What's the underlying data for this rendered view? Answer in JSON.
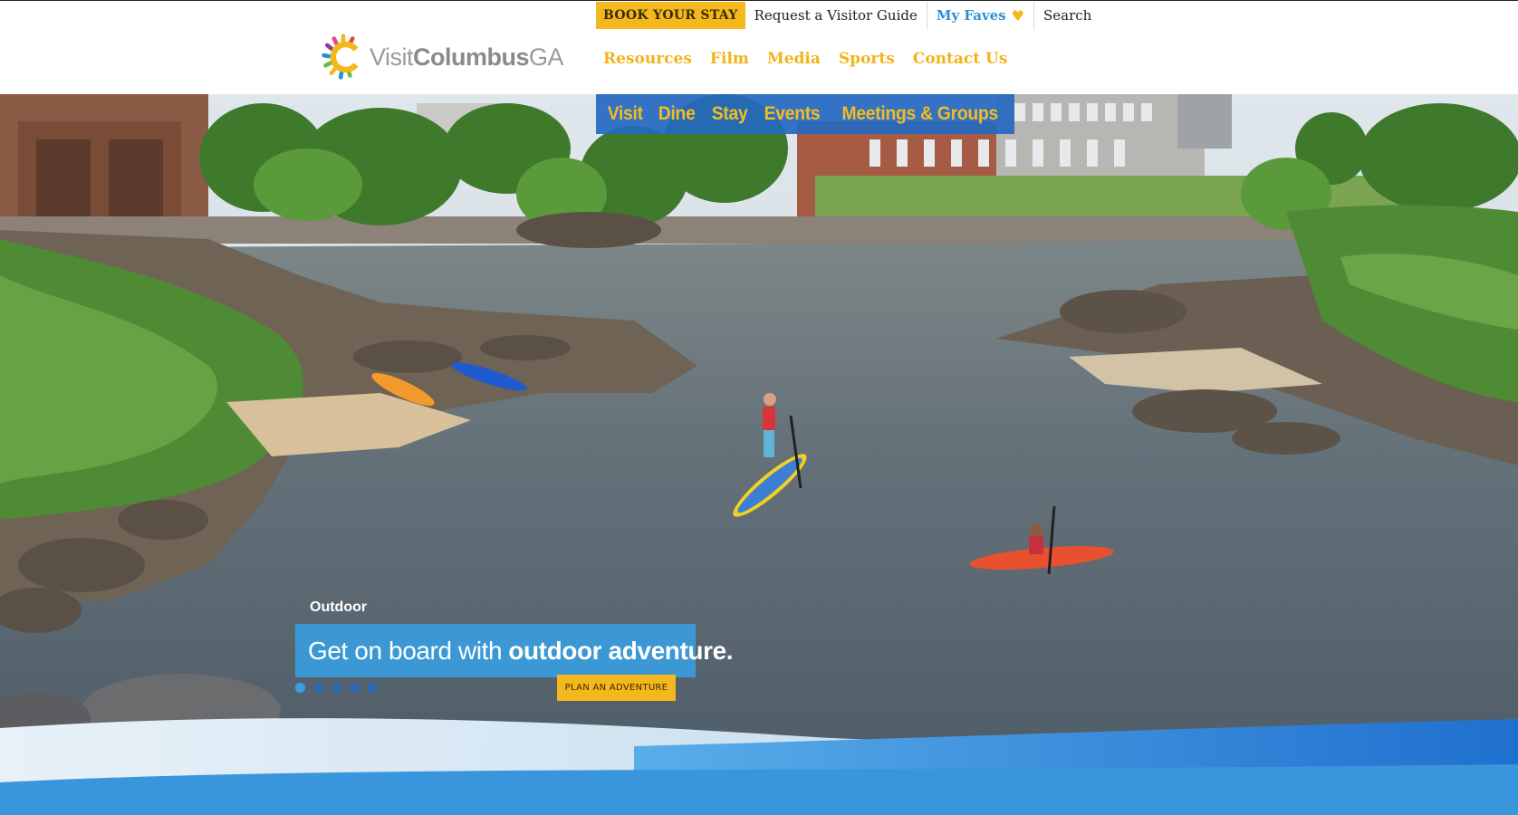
{
  "utility_bar": {
    "book": "BOOK YOUR STAY",
    "guide": "Request a Visitor Guide",
    "faves": "My Faves",
    "faves_icon": "heart-icon",
    "search": "Search"
  },
  "logo": {
    "visit": "Visit",
    "city": "Columbus",
    "state": "GA",
    "colors": [
      "#e84a3a",
      "#f3b81e",
      "#6cbe45",
      "#2c8fd3",
      "#8e3d97",
      "#e7487e"
    ]
  },
  "secondary_nav": [
    "Resources",
    "Film",
    "Media",
    "Sports",
    "Contact Us"
  ],
  "main_nav": [
    "Visit",
    "Dine",
    "Stay",
    "Events",
    "Meetings & Groups"
  ],
  "slide": {
    "category": "Outdoor",
    "headline_regular": "Get on board with",
    "headline_bold": "outdoor adventure.",
    "cta": "PLAN AN ADVENTURE",
    "slide_count": 5,
    "active_slide": 1
  },
  "colors": {
    "accent_yellow": "#f3b81e",
    "accent_blue": "#3a9bd9",
    "nav_blue": "#2468c0"
  }
}
